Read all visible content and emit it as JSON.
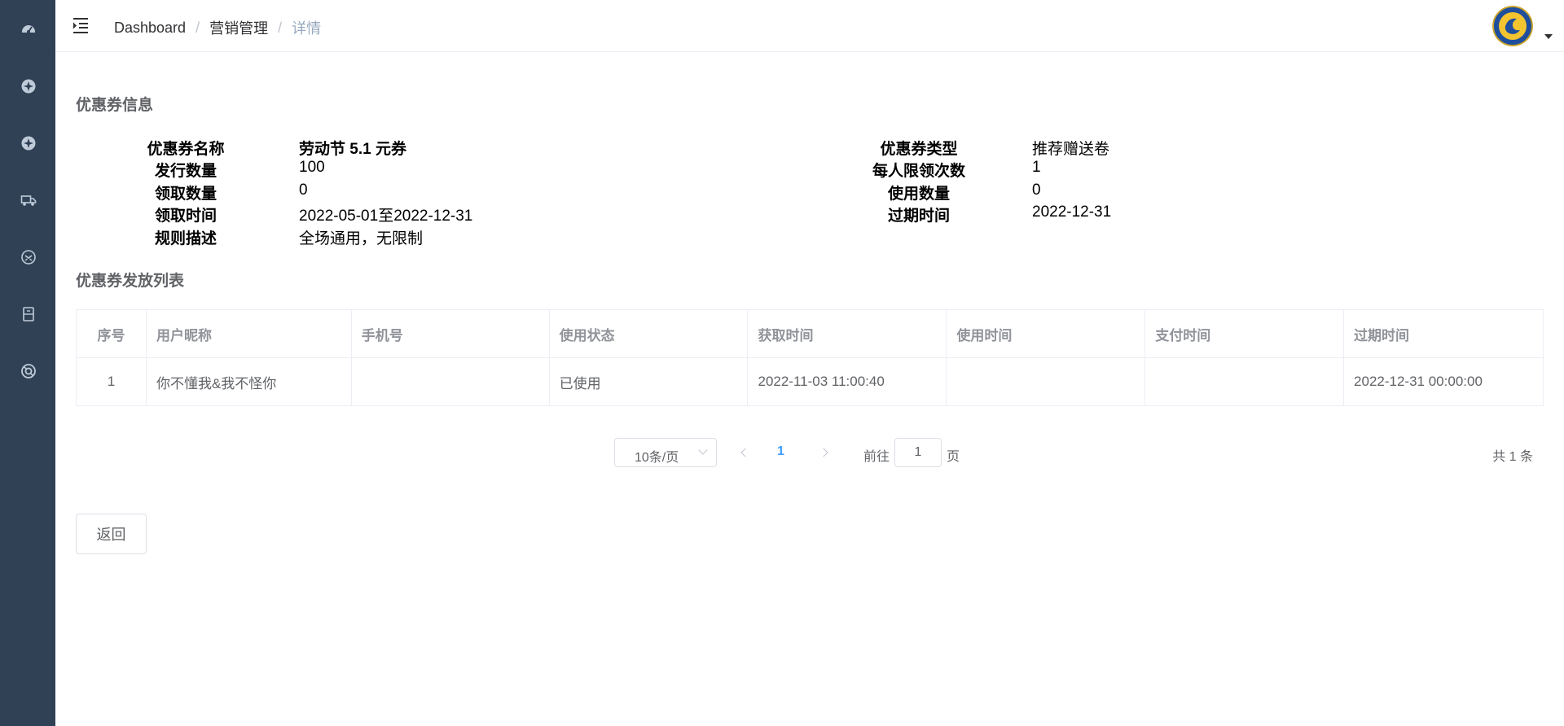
{
  "breadcrumb": [
    "Dashboard",
    "营销管理",
    "详情"
  ],
  "sections": {
    "info_title": "优惠券信息",
    "list_title": "优惠券发放列表"
  },
  "info": {
    "left": [
      {
        "label": "优惠券名称",
        "value": "劳动节 5.1 元券"
      },
      {
        "label": "发行数量",
        "value": "100"
      },
      {
        "label": "领取数量",
        "value": "0"
      },
      {
        "label": "领取时间",
        "value": "2022-05-01至2022-12-31"
      },
      {
        "label": "规则描述",
        "value": "全场通用，无限制"
      }
    ],
    "right": [
      {
        "label": "优惠券类型",
        "value": "推荐赠送卷"
      },
      {
        "label": "每人限领次数",
        "value": "1"
      },
      {
        "label": "使用数量",
        "value": "0"
      },
      {
        "label": "过期时间",
        "value": "2022-12-31"
      }
    ]
  },
  "table": {
    "headers": [
      "序号",
      "用户昵称",
      "手机号",
      "使用状态",
      "获取时间",
      "使用时间",
      "支付时间",
      "过期时间"
    ],
    "rows": [
      [
        "1",
        "你不懂我&我不怪你",
        "",
        "已使用",
        "2022-11-03 11:00:40",
        "",
        "",
        "2022-12-31 00:00:00"
      ]
    ]
  },
  "pagination": {
    "page_size": "10条/页",
    "current_page": "1",
    "goto_prefix": "前往",
    "goto_value": "1",
    "goto_suffix": "页",
    "total": "共 1 条"
  },
  "back_button": "返回",
  "sidebar_icons": [
    "dashboard-icon",
    "marketing-icon",
    "marketing-icon-2",
    "delivery-icon",
    "service-icon",
    "book-icon",
    "support-icon"
  ],
  "colors": {
    "sidebar": "#304156",
    "accent": "#409eff"
  }
}
